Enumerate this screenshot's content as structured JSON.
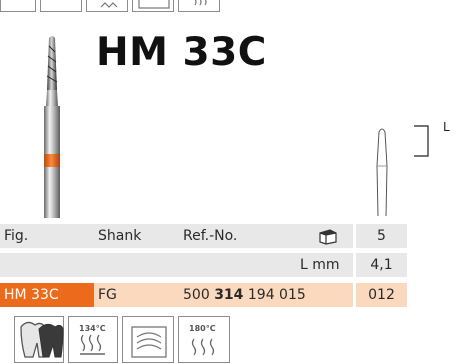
{
  "title": "HM 33C",
  "dimension_marker": "L",
  "table": {
    "header": {
      "fig": "Fig.",
      "shank": "Shank",
      "ref_no": "Ref.-No.",
      "packaging_icon": "package-icon",
      "packaging_value": "5"
    },
    "length_row": {
      "label": "L mm",
      "value": "4,1"
    },
    "product_row": {
      "fig": "HM 33C",
      "shank": "FG",
      "ref_prefix": "500",
      "ref_bold": "314",
      "ref_suffix": "194 015",
      "size": "012"
    }
  },
  "icons_bottom": [
    {
      "name": "tooth-icon"
    },
    {
      "name": "thermo-disinfector-icon",
      "text": "134°C"
    },
    {
      "name": "ultrasonic-bath-icon"
    },
    {
      "name": "sterilizer-icon",
      "text": "180°C"
    }
  ],
  "colors": {
    "accent": "#ec6a1c",
    "highlight_row": "#fbd9be",
    "gray_row": "#e8e8e8"
  }
}
